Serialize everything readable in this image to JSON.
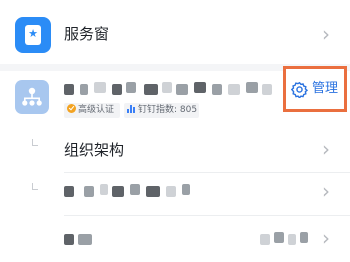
{
  "service_window": {
    "label": "服务窗",
    "icon": "star-bookmark-icon",
    "icon_color": "#2b8cf6"
  },
  "organization": {
    "logo_icon": "org-structure-icon",
    "logo_color": "#a8c7ef",
    "badges": [
      {
        "label": "高级认证",
        "icon": "verified-check-icon"
      },
      {
        "label": "钉钉指数: 805",
        "icon": "bar-chart-icon"
      }
    ],
    "manage": {
      "label": "管理",
      "icon": "gear-icon",
      "highlight_color": "#ea6f3f",
      "text_color": "#2b73e0"
    }
  },
  "departments": [
    {
      "label": "组织架构"
    }
  ]
}
